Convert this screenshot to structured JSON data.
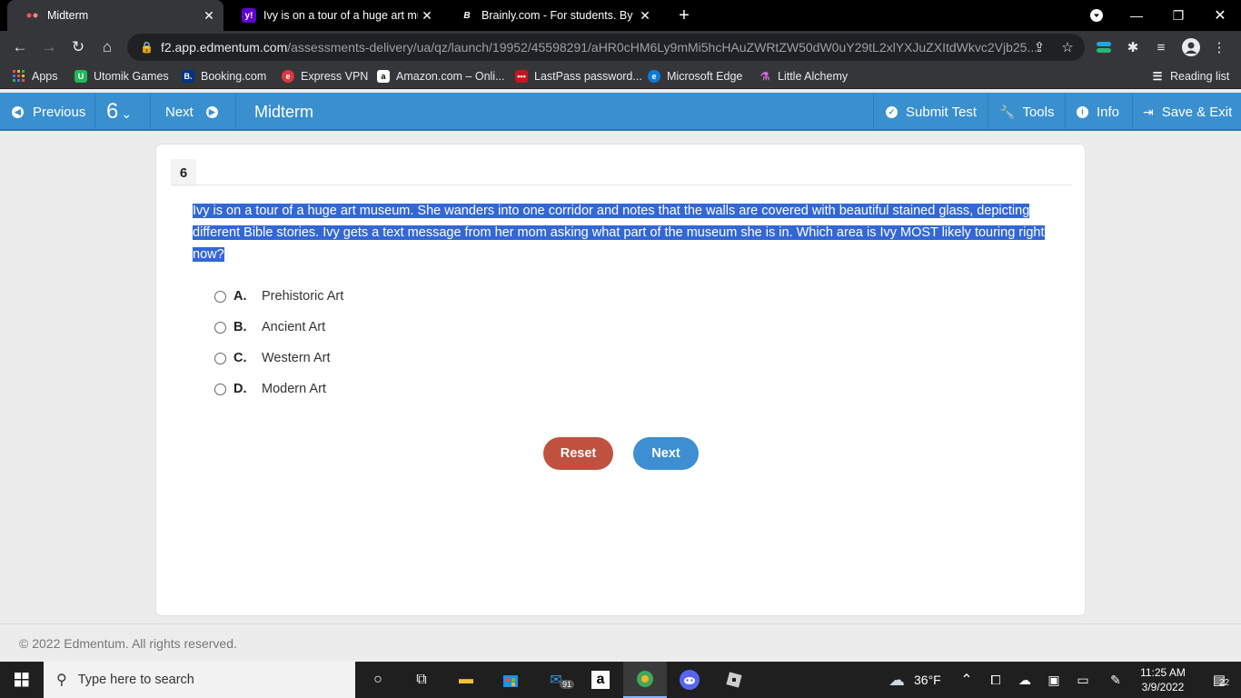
{
  "browser": {
    "tabs": [
      {
        "title": "Midterm",
        "favicon": "edmentum-icon"
      },
      {
        "title": "Ivy is on a tour of a huge art mus",
        "favicon": "yahoo-icon"
      },
      {
        "title": "Brainly.com - For students. By stu",
        "favicon": "brainly-icon"
      }
    ],
    "url_host": "f2.app.edmentum.com",
    "url_path": "/assessments-delivery/ua/qz/launch/19952/45598291/aHR0cHM6Ly9mMi5hcHAuZWRtZW50dW0uY29tL2xlYXJuZXItdWkvc2Vjb25...",
    "bookmarks": [
      "Apps",
      "Utomik Games",
      "Booking.com",
      "Express VPN",
      "Amazon.com – Onli...",
      "LastPass password...",
      "Microsoft Edge",
      "Little Alchemy"
    ],
    "reading_list": "Reading list"
  },
  "header": {
    "previous": "Previous",
    "question_select": "6",
    "next": "Next",
    "title": "Midterm",
    "submit": "Submit Test",
    "tools": "Tools",
    "info": "Info",
    "save_exit": "Save & Exit"
  },
  "question": {
    "number": "6",
    "prompt": "Ivy is on a tour of a huge art museum. She wanders into one corridor and notes that the walls are covered with beautiful stained glass, depicting different Bible stories. Ivy gets a text message from her mom asking what part of the museum she is in. Which area is Ivy MOST likely touring right now?",
    "choices": [
      {
        "letter": "A.",
        "text": "Prehistoric Art"
      },
      {
        "letter": "B.",
        "text": "Ancient Art"
      },
      {
        "letter": "C.",
        "text": "Western Art"
      },
      {
        "letter": "D.",
        "text": "Modern Art"
      }
    ],
    "reset_label": "Reset",
    "next_label": "Next"
  },
  "footer": {
    "copyright": "© 2022 Edmentum. All rights reserved."
  },
  "taskbar": {
    "search_placeholder": "Type here to search",
    "mail_badge": "91",
    "weather": "36°F",
    "time": "11:25 AM",
    "date": "3/9/2022",
    "notifications": "22"
  },
  "colors": {
    "accent": "#3a8fcf",
    "reset": "#c0513f",
    "next": "#3d8fd1",
    "selection": "#3367d6"
  }
}
